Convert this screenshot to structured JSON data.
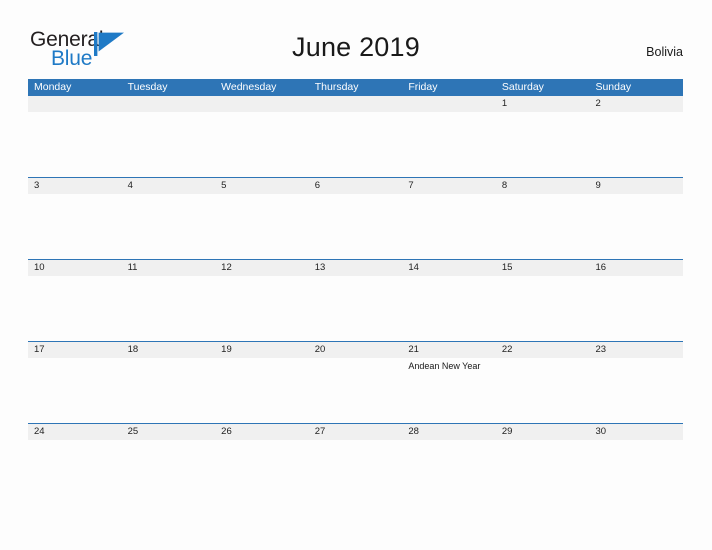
{
  "brand": {
    "word_one": "General",
    "word_two": "Blue",
    "mark": "flag-triangle-icon",
    "accent_color": "#1f7ac6"
  },
  "header": {
    "title": "June 2019",
    "region": "Bolivia"
  },
  "colors": {
    "header_band": "#2e75b6",
    "date_band": "#f0f0f0",
    "rule": "#2e75b6",
    "page_background": "#fdfdfd"
  },
  "calendar": {
    "month": "June",
    "year": "2019",
    "weekday_headers": [
      "Monday",
      "Tuesday",
      "Wednesday",
      "Thursday",
      "Friday",
      "Saturday",
      "Sunday"
    ],
    "weeks": [
      {
        "days": [
          {
            "date": "",
            "events": []
          },
          {
            "date": "",
            "events": []
          },
          {
            "date": "",
            "events": []
          },
          {
            "date": "",
            "events": []
          },
          {
            "date": "",
            "events": []
          },
          {
            "date": "1",
            "events": []
          },
          {
            "date": "2",
            "events": []
          }
        ]
      },
      {
        "days": [
          {
            "date": "3",
            "events": []
          },
          {
            "date": "4",
            "events": []
          },
          {
            "date": "5",
            "events": []
          },
          {
            "date": "6",
            "events": []
          },
          {
            "date": "7",
            "events": []
          },
          {
            "date": "8",
            "events": []
          },
          {
            "date": "9",
            "events": []
          }
        ]
      },
      {
        "days": [
          {
            "date": "10",
            "events": []
          },
          {
            "date": "11",
            "events": []
          },
          {
            "date": "12",
            "events": []
          },
          {
            "date": "13",
            "events": []
          },
          {
            "date": "14",
            "events": []
          },
          {
            "date": "15",
            "events": []
          },
          {
            "date": "16",
            "events": []
          }
        ]
      },
      {
        "days": [
          {
            "date": "17",
            "events": []
          },
          {
            "date": "18",
            "events": []
          },
          {
            "date": "19",
            "events": []
          },
          {
            "date": "20",
            "events": []
          },
          {
            "date": "21",
            "events": [
              "Andean New Year"
            ]
          },
          {
            "date": "22",
            "events": []
          },
          {
            "date": "23",
            "events": []
          }
        ]
      },
      {
        "days": [
          {
            "date": "24",
            "events": []
          },
          {
            "date": "25",
            "events": []
          },
          {
            "date": "26",
            "events": []
          },
          {
            "date": "27",
            "events": []
          },
          {
            "date": "28",
            "events": []
          },
          {
            "date": "29",
            "events": []
          },
          {
            "date": "30",
            "events": []
          }
        ]
      }
    ]
  }
}
